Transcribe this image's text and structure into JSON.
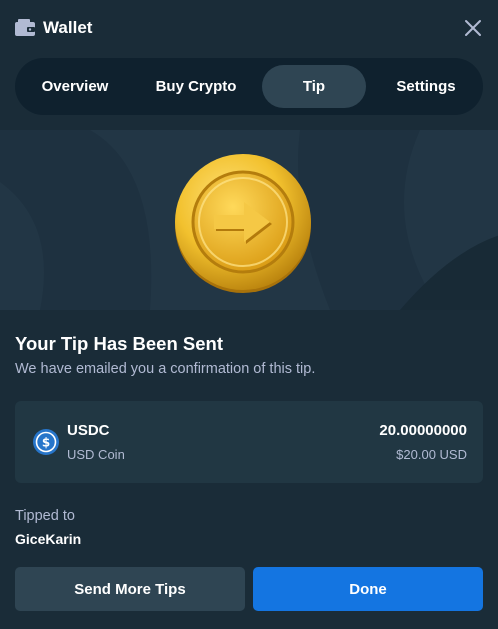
{
  "header": {
    "title": "Wallet",
    "wallet_icon": "wallet-icon",
    "close_icon": "close-icon"
  },
  "tabs": [
    {
      "label": "Overview",
      "active": false
    },
    {
      "label": "Buy Crypto",
      "active": false
    },
    {
      "label": "Tip",
      "active": true
    },
    {
      "label": "Settings",
      "active": false
    }
  ],
  "hero": {
    "icon": "gold-coin-arrow-icon"
  },
  "confirmation": {
    "heading": "Your Tip Has Been Sent",
    "subtext": "We have emailed you a confirmation of this tip."
  },
  "token": {
    "icon": "usdc-icon",
    "symbol": "USDC",
    "name": "USD Coin",
    "amount": "20.00000000",
    "usd_value": "$20.00 USD"
  },
  "recipient": {
    "label": "Tipped to",
    "username": "GiceKarin"
  },
  "actions": {
    "send_more_label": "Send More Tips",
    "done_label": "Done"
  },
  "colors": {
    "background": "#1a2c38",
    "tab_bar": "#0f212e",
    "tab_active": "#2f4553",
    "card": "#213743",
    "primary": "#1475e1",
    "muted_text": "#b1bad3",
    "usdc_blue": "#2775ca",
    "coin_gold": "#f2c12e"
  }
}
